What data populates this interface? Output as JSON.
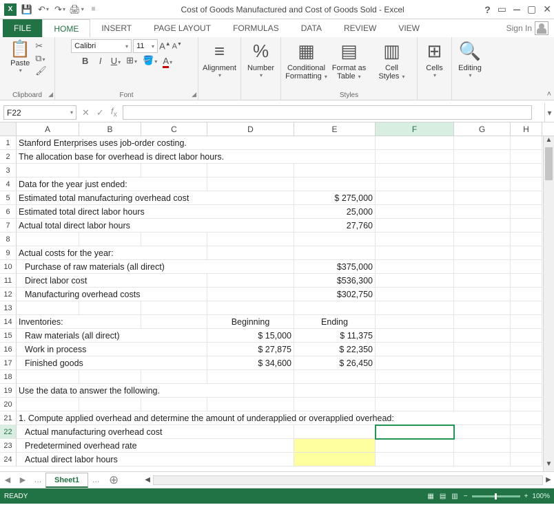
{
  "title": "Cost of Goods Manufactured and Cost of Goods Sold - Excel",
  "signin": "Sign In",
  "tabs": {
    "file": "FILE",
    "home": "HOME",
    "insert": "INSERT",
    "page": "PAGE LAYOUT",
    "formulas": "FORMULAS",
    "data": "DATA",
    "review": "REVIEW",
    "view": "VIEW"
  },
  "ribbon": {
    "clipboard": "Clipboard",
    "paste": "Paste",
    "font": "Font",
    "fontname": "Calibri",
    "fontsize": "11",
    "alignment": "Alignment",
    "number": "Number",
    "styles": "Styles",
    "cond": "Conditional",
    "cond2": "Formatting",
    "fmtas": "Format as",
    "fmtas2": "Table",
    "cellstyles": "Cell",
    "cellstyles2": "Styles",
    "cells": "Cells",
    "editing": "Editing"
  },
  "namebox": "F22",
  "cols": [
    "A",
    "B",
    "C",
    "D",
    "E",
    "F",
    "G",
    "H"
  ],
  "sheet": "Sheet1",
  "status": "READY",
  "zoom": "100%",
  "rows": {
    "r1": "Stanford Enterprises uses job-order costing.",
    "r2": "The allocation base for overhead is direct labor hours.",
    "r4": "Data for the year just ended:",
    "r5a": "Estimated total manufacturing overhead cost",
    "r5e": "$   275,000",
    "r6a": "Estimated total direct labor hours",
    "r6e": "25,000",
    "r7a": "Actual total direct labor hours",
    "r7e": "27,760",
    "r9": "Actual costs for the year:",
    "r10a": "Purchase of raw materials (all direct)",
    "r10e": "$375,000",
    "r11a": "Direct labor cost",
    "r11e": "$536,300",
    "r12a": "Manufacturing overhead costs",
    "r12e": "$302,750",
    "r14a": "Inventories:",
    "r14d": "Beginning",
    "r14e": "Ending",
    "r15a": "Raw materials (all direct)",
    "r15d": "$          15,000",
    "r15e": "$        11,375",
    "r16a": "Work in process",
    "r16d": "$          27,875",
    "r16e": "$        22,350",
    "r17a": "Finished goods",
    "r16d2": "$          34,600",
    "r17e": "$        26,450",
    "r17d": "$          34,600",
    "r19": "Use the data to answer the following.",
    "r21": "1. Compute applied overhead and determine the amount of underapplied or overapplied overhead:",
    "r22": "Actual manufacturing overhead cost",
    "r23": "Predetermined overhead rate",
    "r24": "Actual direct labor hours"
  }
}
